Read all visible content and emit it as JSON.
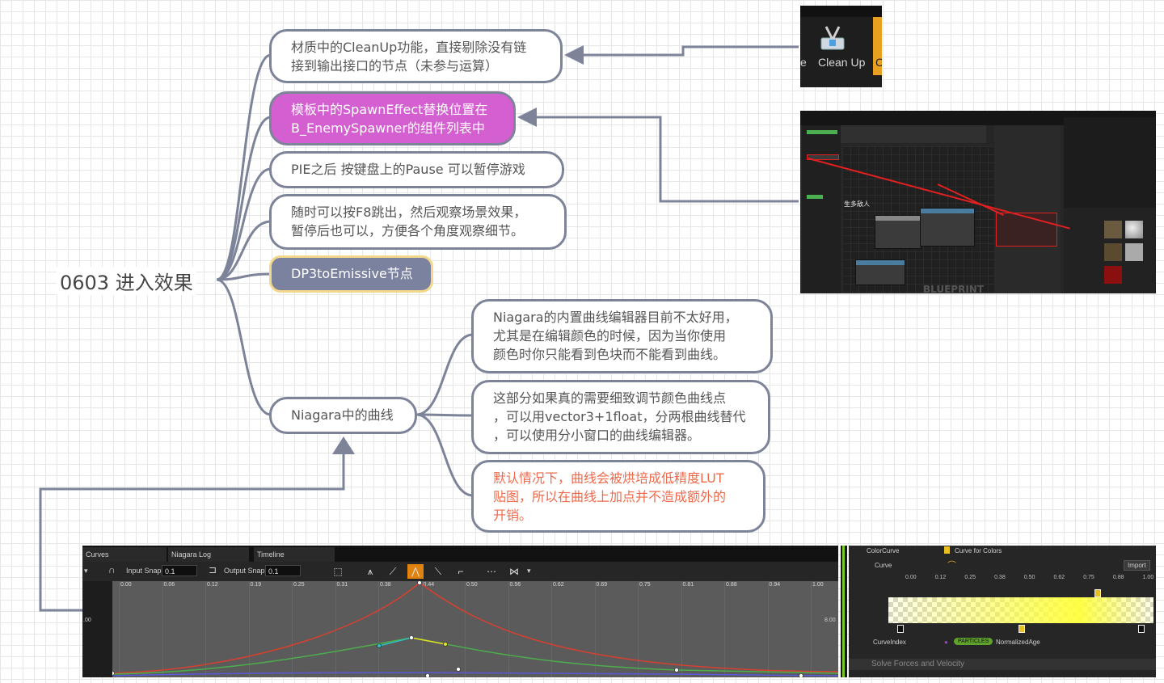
{
  "mindmap": {
    "root": "0603 进入效果",
    "nodes": [
      {
        "text": "材质中的CleanUp功能，直接剔除没有链\n接到输出接口的节点（未参与运算）",
        "style": "normal"
      },
      {
        "text": "模板中的SpawnEffect替换位置在\nB_EnemySpawner的组件列表中",
        "style": "pink"
      },
      {
        "text": "PIE之后 按键盘上的Pause 可以暂停游戏",
        "style": "normal"
      },
      {
        "text": "随时可以按F8跳出，然后观察场景效果，\n暂停后也可以，方便各个角度观察细节。",
        "style": "normal"
      },
      {
        "text": "DP3toEmissive节点",
        "style": "gray"
      },
      {
        "text": "Niagara中的曲线",
        "style": "normal"
      }
    ],
    "niagara_children": [
      {
        "text": "Niagara的内置曲线编辑器目前不太好用，\n尤其是在编辑颜色的时候，因为当你使用\n颜色时你只能看到色块而不能看到曲线。",
        "style": "normal"
      },
      {
        "text": "这部分如果真的需要细致调节颜色曲线点\n，可以用vector3+1float，分两根曲线替代\n，可以使用分小窗口的曲线编辑器。",
        "style": "normal"
      },
      {
        "text": "默认情况下，曲线会被烘培成低精度LUT\n贴图，所以在曲线上加点并不造成额外的\n开销。",
        "style": "red"
      }
    ],
    "colors": {
      "line": "#7d8499",
      "pink": "#d45fd0",
      "gray_node": "#7b82a0",
      "gray_border": "#f3d88c",
      "red_text": "#ee6a4c"
    }
  },
  "cleanup_snippet": {
    "label": "Clean Up",
    "left_fragment": "e",
    "right_fragment": "C"
  },
  "blueprint_snippet": {
    "graph_text": "生多敌人",
    "watermark": "BLUEPRINT"
  },
  "curve_editor": {
    "tabs": [
      "Curves",
      "Niagara Log",
      "Timeline"
    ],
    "input_snap_label": "Input Snap",
    "input_snap_value": "0.1",
    "output_snap_label": "Output Snap",
    "output_snap_value": "0.1",
    "x_ticks": [
      "0.00",
      "0.06",
      "0.12",
      "0.19",
      "0.25",
      "0.31",
      "0.38",
      "0.44",
      "0.50",
      "0.56",
      "0.62",
      "0.69",
      "0.75",
      "0.81",
      "0.88",
      "0.94",
      "1.00"
    ],
    "y_tick_left": ".00",
    "y_tick_right": "8.00"
  },
  "details_panel": {
    "colorcurve_label": "ColorCurve",
    "colorcurve_value": "Curve for Colors",
    "curve_label": "Curve",
    "import_label": "Import",
    "x_ticks": [
      "0.00",
      "0.12",
      "0.25",
      "0.38",
      "0.50",
      "0.62",
      "0.75",
      "0.88",
      "1.00"
    ],
    "curveindex_label": "CurveIndex",
    "particles_badge": "PARTICLES",
    "normalized_age": "NormalizedAge",
    "section_label": "Solve Forces and Velocity"
  }
}
